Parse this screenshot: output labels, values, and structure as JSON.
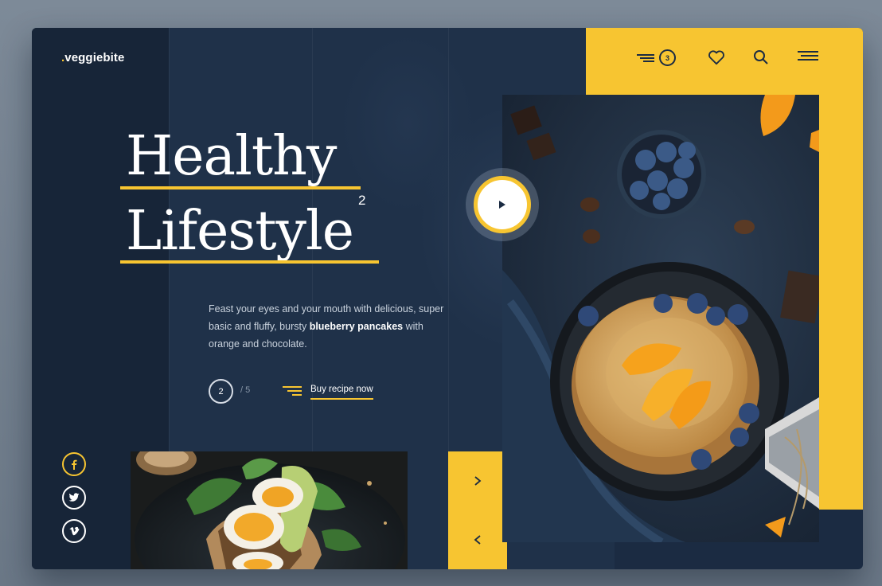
{
  "brand": {
    "dot": ".",
    "name": "veggiebite"
  },
  "nav": {
    "cart_count": "3",
    "icons": [
      "filter-lines-icon",
      "heart-icon",
      "search-icon",
      "menu-icon"
    ]
  },
  "hero": {
    "line1": "Healthy",
    "line2": "Lifestyle",
    "superscript": "2",
    "desc_before": "Feast your eyes and your mouth with delicious, super basic and fluffy, bursty ",
    "desc_bold": "blueberry pancakes",
    "desc_after": " with orange and chocolate.",
    "slide_current": "2",
    "slide_total": "/ 5",
    "cta": "Buy recipe now"
  },
  "social": [
    "facebook-icon",
    "twitter-icon",
    "vimeo-icon"
  ],
  "colors": {
    "accent": "#f7c531",
    "background": "#1b2b42",
    "panel": "#172538"
  }
}
